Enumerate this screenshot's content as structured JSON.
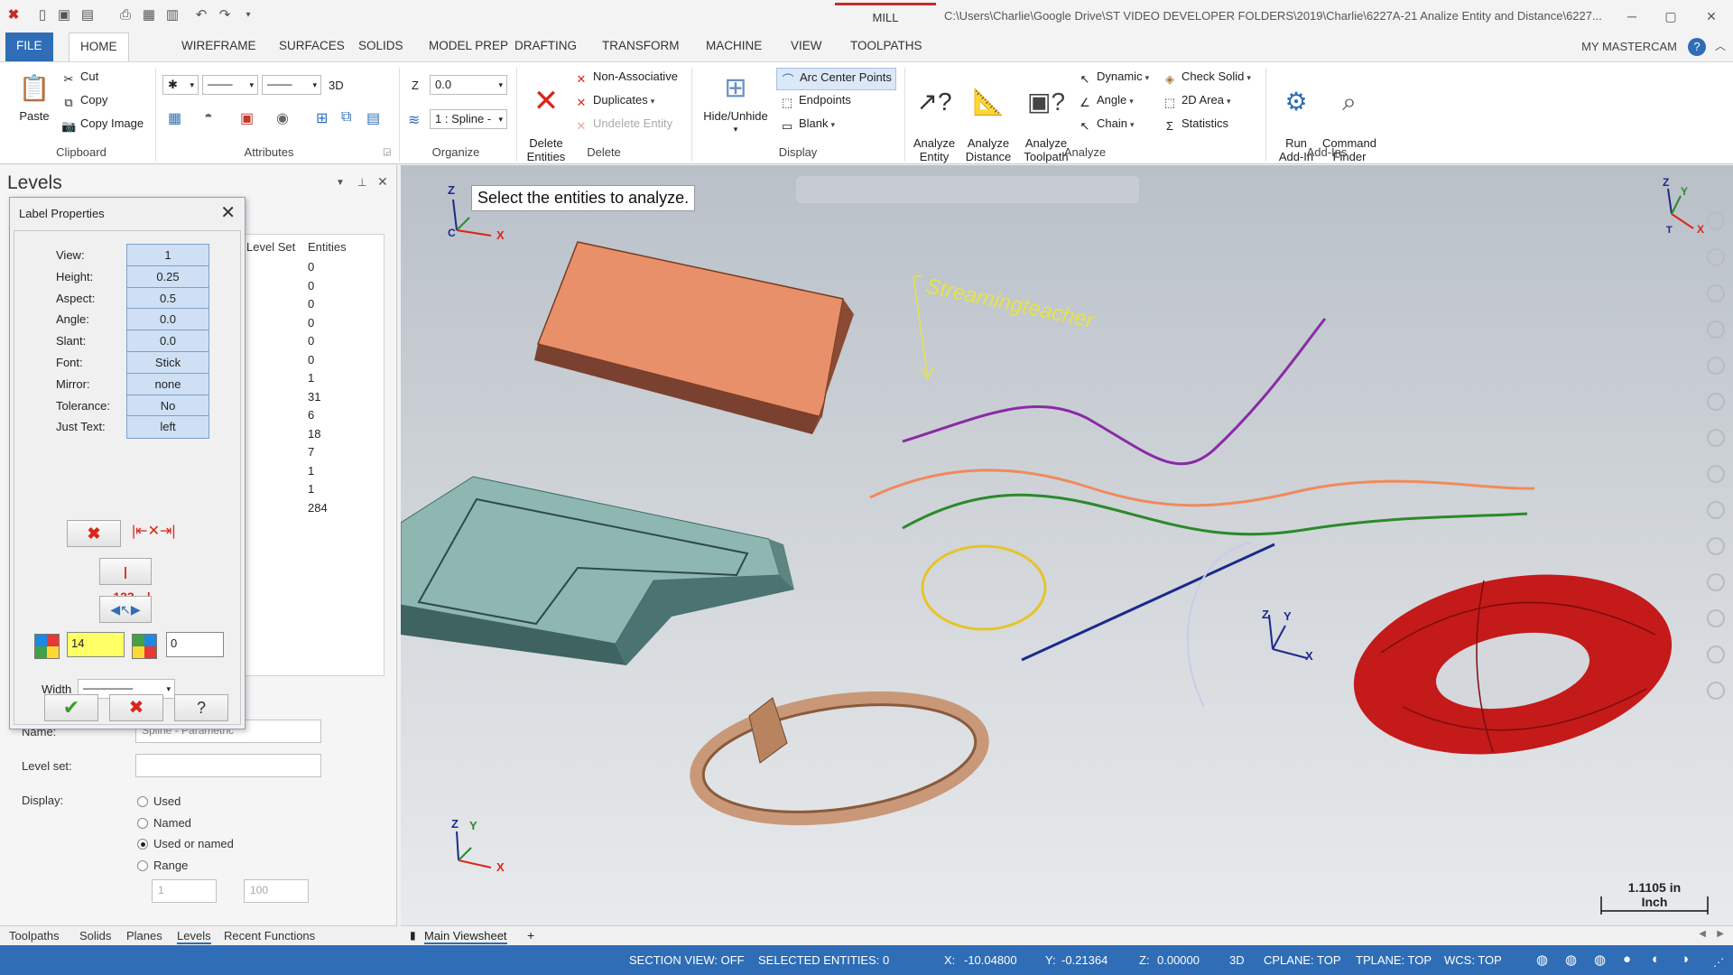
{
  "titlebar": {
    "mode": "MILL",
    "path": "C:\\Users\\Charlie\\Google Drive\\ST VIDEO DEVELOPER FOLDERS\\2019\\Charlie\\6227A-21 Analize Entity and Distance\\6227..."
  },
  "tabs": [
    "FILE",
    "HOME",
    "WIREFRAME",
    "SURFACES",
    "SOLIDS",
    "MODEL PREP",
    "DRAFTING",
    "TRANSFORM",
    "MACHINE",
    "VIEW",
    "TOOLPATHS"
  ],
  "my_mastercam": "MY MASTERCAM",
  "ribbon": {
    "clipboard": {
      "paste": "Paste",
      "cut": "Cut",
      "copy": "Copy",
      "copy_image": "Copy Image",
      "label": "Clipboard"
    },
    "attributes": {
      "mode3d": "3D",
      "label": "Attributes"
    },
    "organize": {
      "z_label": "Z",
      "z_value": "0.0",
      "level": "1 : Spline -",
      "label": "Organize"
    },
    "delete": {
      "delete_entities": "Delete\nEntities",
      "non_assoc": "Non-Associative",
      "duplicates": "Duplicates",
      "undelete": "Undelete Entity",
      "label": "Delete"
    },
    "display": {
      "hide_unhide": "Hide/Unhide",
      "arc_centers": "Arc Center Points",
      "endpoints": "Endpoints",
      "blank": "Blank",
      "label": "Display"
    },
    "analyze": {
      "entity": "Analyze\nEntity",
      "distance": "Analyze\nDistance",
      "toolpath": "Analyze\nToolpath",
      "dynamic": "Dynamic",
      "angle": "Angle",
      "chain": "Chain",
      "check_solid": "Check Solid",
      "area2d": "2D Area",
      "statistics": "Statistics",
      "label": "Analyze"
    },
    "addins": {
      "run": "Run\nAdd-In",
      "finder": "Command\nFinder",
      "label": "Add-Ins"
    }
  },
  "levels": {
    "title": "Levels",
    "col_level_set": "Level Set",
    "col_entities": "Entities",
    "entities": [
      "0",
      "0",
      "0",
      "0",
      "0",
      "0",
      "1",
      "31",
      "6",
      "18",
      "7",
      "1",
      "1",
      "284"
    ],
    "name_label": "Name:",
    "name_value": "Spline - Parametric",
    "level_set_label": "Level set:",
    "display_label": "Display:",
    "radios": [
      "Used",
      "Named",
      "Used or named",
      "Range"
    ],
    "selected_radio": "Used or named",
    "range_from": "1",
    "range_to": "100"
  },
  "dialog": {
    "title": "Label Properties",
    "props": [
      {
        "label": "View:",
        "value": "1"
      },
      {
        "label": "Height:",
        "value": "0.25"
      },
      {
        "label": "Aspect:",
        "value": "0.5"
      },
      {
        "label": "Angle:",
        "value": "0.0"
      },
      {
        "label": "Slant:",
        "value": "0.0"
      },
      {
        "label": "Font:",
        "value": "Stick"
      },
      {
        "label": "Mirror:",
        "value": "none"
      },
      {
        "label": "Tolerance:",
        "value": "No"
      },
      {
        "label": "Just Text:",
        "value": "left"
      }
    ],
    "dim_label": "|←123→|",
    "color_value": "14",
    "color2_value": "0",
    "width_label": "Width"
  },
  "viewport": {
    "prompt": "Select the entities to analyze.",
    "watermark": "Streamingteacher",
    "scale_value": "1.1105 in",
    "scale_unit": "Inch",
    "axis_x": "X",
    "axis_y": "Y",
    "axis_z": "Z",
    "axis_c": "C",
    "axis_t": "T"
  },
  "bottom_tabs": [
    "Toolpaths",
    "Solids",
    "Planes",
    "Levels",
    "Recent Functions"
  ],
  "viewsheet": "Main Viewsheet",
  "status": {
    "section_view": "SECTION VIEW: OFF",
    "selected": "SELECTED ENTITIES: 0",
    "x_label": "X:",
    "x": "-10.04800",
    "y_label": "Y:",
    "y": "-0.21364",
    "z_label": "Z:",
    "z": "0.00000",
    "mode": "3D",
    "cplane": "CPLANE: TOP",
    "tplane": "TPLANE: TOP",
    "wcs": "WCS: TOP"
  },
  "colors": {
    "accent": "#2f6db6",
    "brand_red": "#c42b2b"
  }
}
